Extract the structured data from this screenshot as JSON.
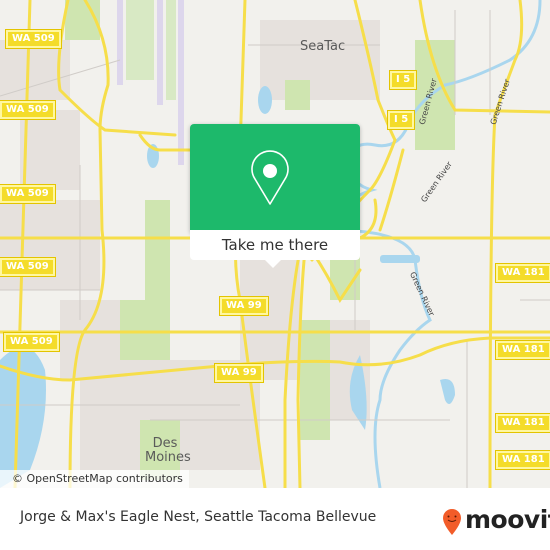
{
  "map": {
    "place_labels": [
      {
        "name": "SeaTac"
      },
      {
        "name": "Des Moines"
      }
    ],
    "road_shields": [
      {
        "label": "WA 509"
      },
      {
        "label": "WA 509"
      },
      {
        "label": "WA 509"
      },
      {
        "label": "WA 509"
      },
      {
        "label": "WA 509"
      },
      {
        "label": "WA 99"
      },
      {
        "label": "WA 99"
      },
      {
        "label": "I 5"
      },
      {
        "label": "I 5"
      },
      {
        "label": "WA 181"
      },
      {
        "label": "WA 181"
      },
      {
        "label": "WA 181"
      },
      {
        "label": "WA 181"
      }
    ],
    "river_labels": [
      {
        "name": "Green River"
      },
      {
        "name": "Green River"
      },
      {
        "name": "Green River"
      },
      {
        "name": "Green River"
      }
    ],
    "attribution": "© OpenStreetMap contributors",
    "colors": {
      "land": "#f2f1ed",
      "road": "#f6de4a",
      "water": "#a9d6ee",
      "park": "#cfe5b0",
      "urban": "#e6e1dd",
      "runway": "#ddd6ec"
    }
  },
  "popup": {
    "icon": "map-pin-icon",
    "button_label": "Take me there",
    "accent_color": "#1db96b"
  },
  "footer": {
    "title": "Jorge & Max's Eagle Nest, Seattle Tacoma Bellevue",
    "brand": {
      "icon": "moovit-pin-icon",
      "name": "moovit",
      "color": "#f25c29"
    }
  }
}
